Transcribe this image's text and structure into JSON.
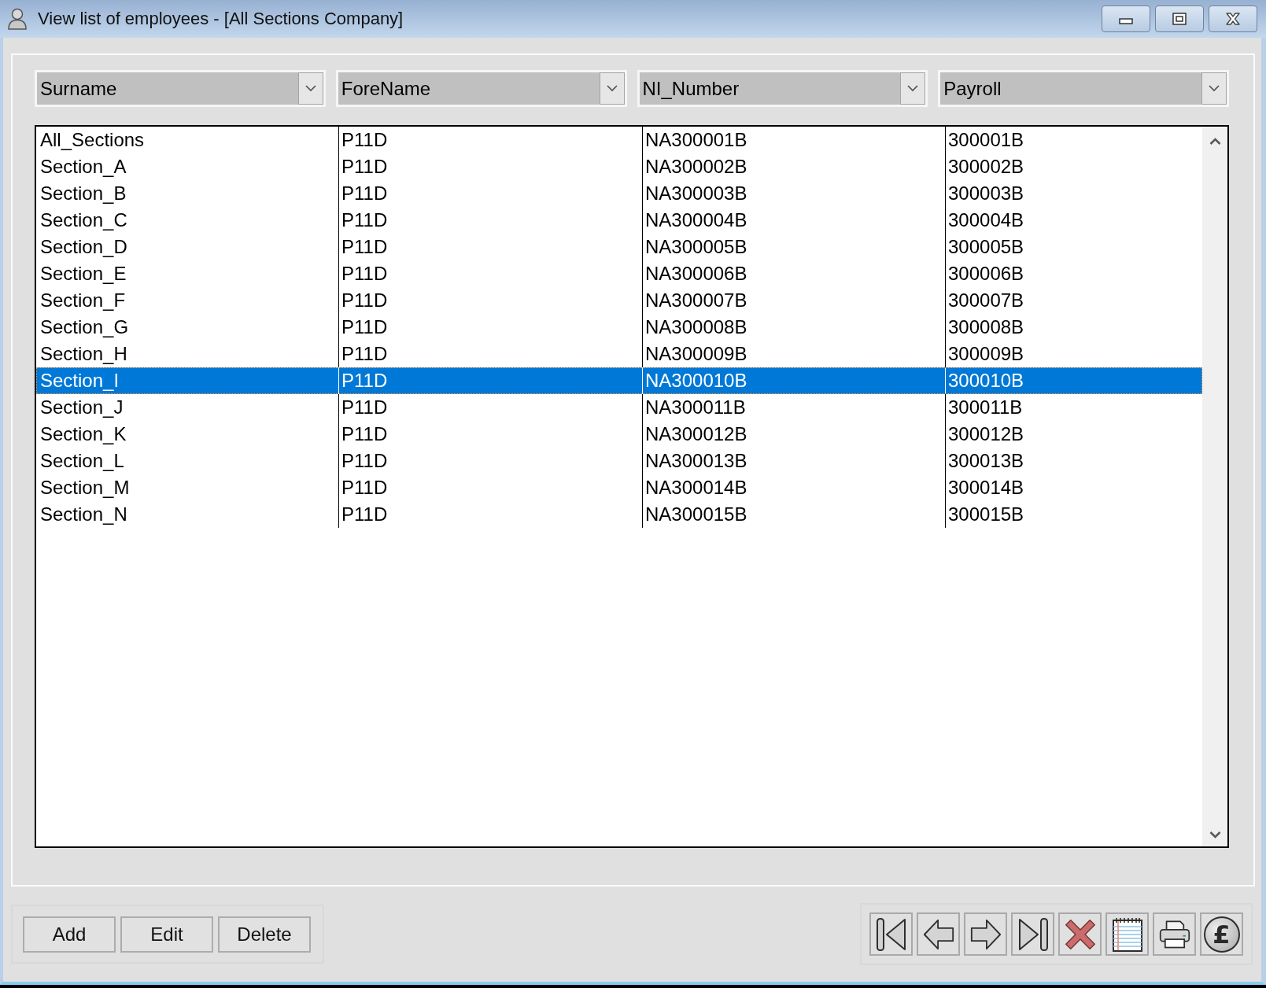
{
  "window": {
    "title": "View list of employees - [All Sections Company]"
  },
  "column_selectors": [
    "Surname",
    "ForeName",
    "NI_Number",
    "Payroll"
  ],
  "table": {
    "rows": [
      {
        "cells": [
          "All_Sections",
          "P11D",
          "NA300001B",
          "300001B"
        ],
        "selected": false
      },
      {
        "cells": [
          "Section_A",
          "P11D",
          "NA300002B",
          "300002B"
        ],
        "selected": false
      },
      {
        "cells": [
          "Section_B",
          "P11D",
          "NA300003B",
          "300003B"
        ],
        "selected": false
      },
      {
        "cells": [
          "Section_C",
          "P11D",
          "NA300004B",
          "300004B"
        ],
        "selected": false
      },
      {
        "cells": [
          "Section_D",
          "P11D",
          "NA300005B",
          "300005B"
        ],
        "selected": false
      },
      {
        "cells": [
          "Section_E",
          "P11D",
          "NA300006B",
          "300006B"
        ],
        "selected": false
      },
      {
        "cells": [
          "Section_F",
          "P11D",
          "NA300007B",
          "300007B"
        ],
        "selected": false
      },
      {
        "cells": [
          "Section_G",
          "P11D",
          "NA300008B",
          "300008B"
        ],
        "selected": false
      },
      {
        "cells": [
          "Section_H",
          "P11D",
          "NA300009B",
          "300009B"
        ],
        "selected": false
      },
      {
        "cells": [
          "Section_I",
          "P11D",
          "NA300010B",
          "300010B"
        ],
        "selected": true
      },
      {
        "cells": [
          "Section_J",
          "P11D",
          "NA300011B",
          "300011B"
        ],
        "selected": false
      },
      {
        "cells": [
          "Section_K",
          "P11D",
          "NA300012B",
          "300012B"
        ],
        "selected": false
      },
      {
        "cells": [
          "Section_L",
          "P11D",
          "NA300013B",
          "300013B"
        ],
        "selected": false
      },
      {
        "cells": [
          "Section_M",
          "P11D",
          "NA300014B",
          "300014B"
        ],
        "selected": false
      },
      {
        "cells": [
          "Section_N",
          "P11D",
          "NA300015B",
          "300015B"
        ],
        "selected": false
      }
    ]
  },
  "buttons": [
    "Add",
    "Edit",
    "Delete"
  ],
  "toolbar": {
    "currency_symbol": "£"
  }
}
